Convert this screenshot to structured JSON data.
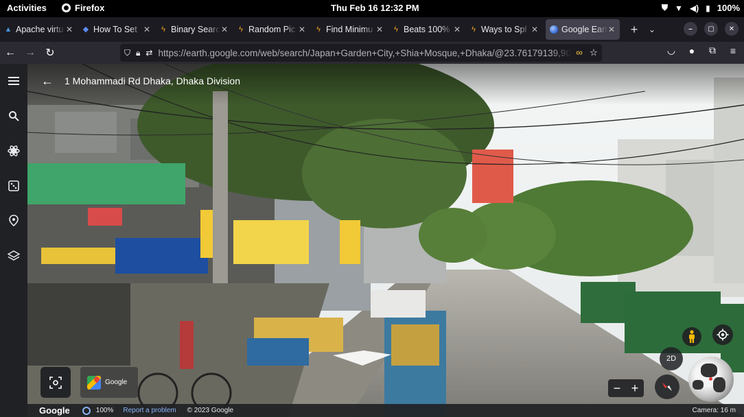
{
  "system": {
    "activities": "Activities",
    "app": "Firefox",
    "clock": "Thu Feb 16  12:32 PM",
    "battery": "100%"
  },
  "tabs": [
    {
      "label": "Apache virtu",
      "icon": "apache-icon"
    },
    {
      "label": "How To Set",
      "icon": "stack-icon"
    },
    {
      "label": "Binary Searc",
      "icon": "lightning-icon"
    },
    {
      "label": "Random Pic",
      "icon": "lightning-icon"
    },
    {
      "label": "Find Minimu",
      "icon": "lightning-icon"
    },
    {
      "label": "Beats 100%",
      "icon": "lightning-icon"
    },
    {
      "label": "Ways to Spl",
      "icon": "lightning-icon"
    },
    {
      "label": "Google Earth",
      "icon": "earth-icon",
      "active": true
    }
  ],
  "navbar": {
    "url_domain": "https://earth.google.com",
    "url_path": "/web/search/Japan+Garden+City,+Shia+Mosque,+Dhaka/@23.76179139,90..."
  },
  "earth": {
    "address": "1 Mohammadi Rd Dhaka, Dhaka Division",
    "thumb_label": "Google",
    "zoom_out": "−",
    "zoom_in": "+",
    "view_mode": "2D",
    "status": {
      "logo": "Google",
      "loading": "100%",
      "report": "Report a problem",
      "copyright": "© 2023 Google",
      "camera": "Camera: 16 m"
    }
  },
  "colors": {
    "side_bg": "#202124",
    "tab_bar": "#1c1b22",
    "nav_bar": "#2b2a33",
    "link": "#8ab4f8"
  }
}
